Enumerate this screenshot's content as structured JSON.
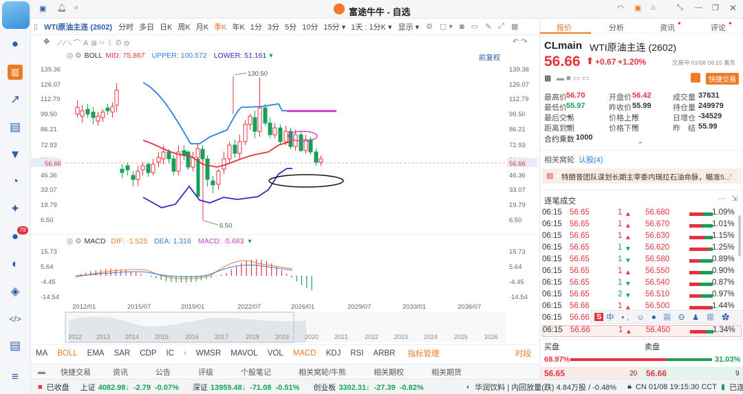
{
  "window": {
    "title": "富途牛牛 - 自选"
  },
  "toolbar": {
    "instrument": "WTI原油主连 (2602)",
    "periods": [
      "分时",
      "多日",
      "日K",
      "周K",
      "月K",
      "季K",
      "年K",
      "1分",
      "3分",
      "5分",
      "10分",
      "15分 ▾",
      "1天 : 1分K ▾"
    ],
    "active_period": "季K",
    "display": "显示 ▾"
  },
  "chart_tools": {
    "boll": {
      "name": "BOLL",
      "mid_label": "MID:",
      "mid": "75.867",
      "upper_label": "UPPER:",
      "upper": "100.572",
      "lower_label": "LOWER:",
      "lower": "51.161"
    },
    "adjust": "前复权"
  },
  "price_axis": {
    "ticks": [
      "139.36",
      "126.07",
      "112.79",
      "99.50",
      "86.21",
      "72.93",
      "59.64",
      "56.66",
      "46.36",
      "33.07",
      "19.79",
      "6.50"
    ],
    "current": "56.66"
  },
  "annotations": {
    "high": "130.50",
    "low": "6.50"
  },
  "macd": {
    "name": "MACD",
    "dif_label": "DIF:",
    "dif": "-1.525",
    "dea_label": "DEA:",
    "dea": "1.316",
    "macd_label": "MACD:",
    "macd": "-5.683",
    "ticks": [
      "15.73",
      "5.64",
      "-4.45",
      "-14.54"
    ]
  },
  "time_axis": [
    "2012/01",
    "2015/07",
    "2019/01",
    "2022/07",
    "2026/01",
    "2029/07",
    "2033/01",
    "2036/07"
  ],
  "mini_axis": [
    "2012",
    "2013",
    "2014",
    "2015",
    "2016",
    "2017",
    "2018",
    "2019",
    "2020",
    "2021",
    "2022",
    "2023",
    "2024",
    "2025",
    "2026"
  ],
  "indicators": [
    "MA",
    "BOLL",
    "EMA",
    "SAR",
    "CDP",
    "IC",
    "WMSR",
    "MAVOL",
    "VOL",
    "MACD",
    "KDJ",
    "RSI",
    "ARBR"
  ],
  "indicators_active": [
    "BOLL",
    "MACD"
  ],
  "indicator_manage": "指标管理",
  "period_label": "时段",
  "info_tabs": [
    "快捷交易",
    "资讯",
    "公告",
    "评级",
    "个股笔记",
    "相关窝轮/牛熊",
    "相关期权",
    "相关期货"
  ],
  "status": {
    "market": "已收盘",
    "indices": [
      {
        "name": "上证",
        "value": "4082.98↓",
        "change": "-2.79",
        "pct": "-0.07%"
      },
      {
        "name": "深证",
        "value": "13959.48↓",
        "change": "-71.08",
        "pct": "-0.51%"
      },
      {
        "name": "创业板",
        "value": "3302.31↓",
        "change": "-27.39",
        "pct": "-0.82%"
      }
    ],
    "news": "华润饮料 | 内回放量(跌) 4.84万股 / -0.48%",
    "clock": "CN 01/08 19:15:30 CCT",
    "connection": "已连接"
  },
  "right_panel": {
    "tabs": [
      "报价",
      "分析",
      "资讯",
      "评论"
    ],
    "active_tab": "报价",
    "symbol": "CLmain",
    "name": "WTI原油主连 (2602)",
    "price": "56.66",
    "change": "+0.67",
    "pct": "+1.20%",
    "trade_time": "交易中 01/08 06:15 美东",
    "quick_trade": "快捷交易",
    "stats": [
      {
        "label": "最高价",
        "value": "56.70",
        "color": "up"
      },
      {
        "label": "开盘价",
        "value": "56.42",
        "color": "up"
      },
      {
        "label": "成交量",
        "value": "37631",
        "color": "normal"
      },
      {
        "label": "最低价",
        "value": "55.97",
        "color": "dn"
      },
      {
        "label": "昨收价",
        "value": "55.99",
        "color": "normal"
      },
      {
        "label": "持仓量",
        "value": "249979",
        "color": "normal"
      },
      {
        "label": "最后交易",
        "value": "--",
        "color": "normal"
      },
      {
        "label": "价格上限",
        "value": "--",
        "color": "normal"
      },
      {
        "label": "日增仓",
        "value": "-34529",
        "color": "normal"
      },
      {
        "label": "距离到期",
        "value": "--",
        "color": "normal"
      },
      {
        "label": "价格下限",
        "value": "--",
        "color": "normal"
      },
      {
        "label": "昨　结",
        "value": "55.99",
        "color": "normal"
      }
    ],
    "multiplier_label": "合约乘数",
    "multiplier": "1000",
    "related_label": "相关窝轮",
    "related_link": "认股(4)",
    "news_headline": "特朗普团队谋划长期主宰委内瑞拉石油命脉，瞄准5...",
    "trades_title": "逐笔成交",
    "trades": [
      {
        "t": "06:15",
        "p": "56.65",
        "q": "1",
        "d": "up",
        "p2": "56.680",
        "pct": "1.09%"
      },
      {
        "t": "06:15",
        "p": "56.65",
        "q": "1",
        "d": "up",
        "p2": "56.670",
        "pct": "1.01%"
      },
      {
        "t": "06:15",
        "p": "56.65",
        "q": "1",
        "d": "up",
        "p2": "56.630",
        "pct": "1.15%"
      },
      {
        "t": "06:15",
        "p": "56.65",
        "q": "1",
        "d": "dn",
        "p2": "56.620",
        "pct": "1.25%"
      },
      {
        "t": "06:15",
        "p": "56.65",
        "q": "1",
        "d": "dn",
        "p2": "56.580",
        "pct": "0.89%"
      },
      {
        "t": "06:15",
        "p": "56.65",
        "q": "1",
        "d": "up",
        "p2": "56.550",
        "pct": "0.90%"
      },
      {
        "t": "06:15",
        "p": "56.65",
        "q": "1",
        "d": "dn",
        "p2": "56.540",
        "pct": "0.87%"
      },
      {
        "t": "06:15",
        "p": "56.65",
        "q": "2",
        "d": "dn",
        "p2": "56.510",
        "pct": "0.97%"
      },
      {
        "t": "06:15",
        "p": "56.66",
        "q": "1",
        "d": "up",
        "p2": "56.500",
        "pct": "1.44%"
      },
      {
        "t": "06:15",
        "p": "56.66",
        "q": "",
        "d": "",
        "p2": "",
        "pct": ""
      },
      {
        "t": "06:15",
        "p": "56.66",
        "q": "1",
        "d": "up",
        "p2": "56.450",
        "pct": "1.34%"
      }
    ],
    "order_book": {
      "bid_label": "买盘",
      "ask_label": "卖盘",
      "bid_pct": "68.97%",
      "ask_pct": "31.03%",
      "bid_price": "56.65",
      "bid_qty": "20",
      "ask_price": "56.66",
      "ask_qty": "9"
    }
  }
}
